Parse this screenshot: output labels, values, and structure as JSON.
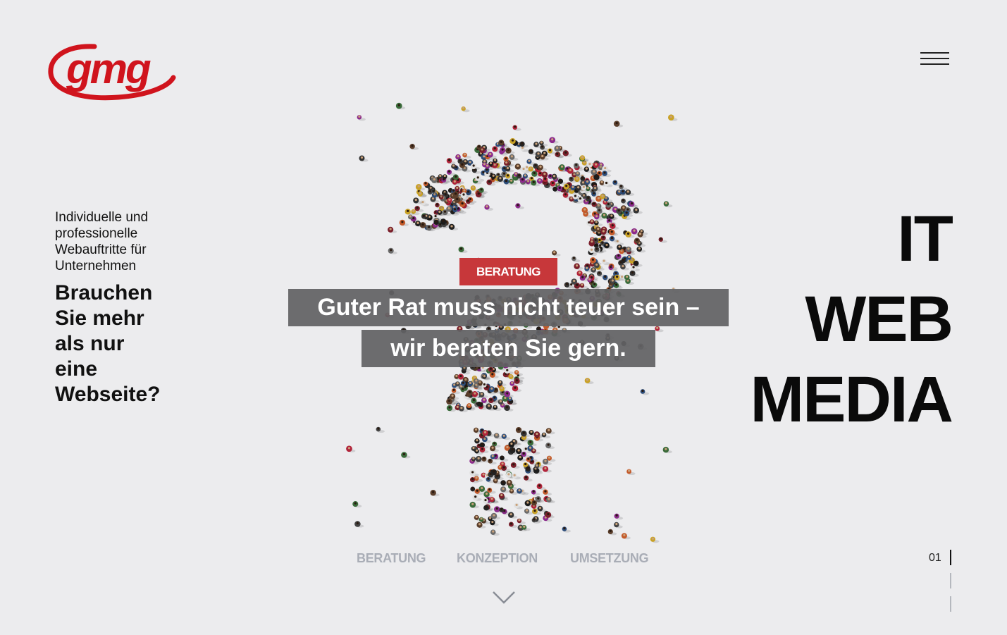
{
  "brand": {
    "logo_text": "gmg",
    "color": "#d0141d"
  },
  "menu": {
    "icon": "hamburger-menu-icon"
  },
  "intro": {
    "subtitle_lines": [
      "Individuelle und",
      "professionelle",
      "Webauftritte für",
      "Unternehmen"
    ],
    "question_lines": [
      "Brauchen",
      "Sie mehr",
      "als nur",
      "eine",
      "Webseite?"
    ]
  },
  "slide": {
    "badge": "BERATUNG",
    "badge_color": "#c7373a",
    "headline_line1": "Guter Rat muss nicht teuer sein –",
    "headline_line2": "wir beraten Sie gern."
  },
  "big_words": [
    "IT",
    "WEB",
    "MEDIA"
  ],
  "tabs": [
    {
      "label": "BERATUNG"
    },
    {
      "label": "KONZEPTION"
    },
    {
      "label": "UMSETZUNG"
    }
  ],
  "scroll": {
    "icon": "chevron-down-icon"
  },
  "pager": {
    "current": "01",
    "total_bars": 3
  }
}
